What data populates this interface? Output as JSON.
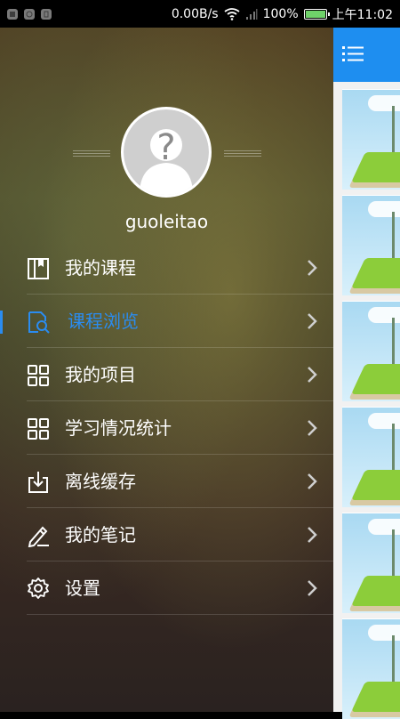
{
  "status_bar": {
    "net_speed": "0.00B/s",
    "battery_percent": "100%",
    "time": "上午11:02"
  },
  "drawer": {
    "username": "guoleitao",
    "items": [
      {
        "label": "我的课程",
        "icon": "book-icon",
        "active": false
      },
      {
        "label": "课程浏览",
        "icon": "course-browse-icon",
        "active": true
      },
      {
        "label": "我的项目",
        "icon": "grid-icon",
        "active": false
      },
      {
        "label": "学习情况统计",
        "icon": "grid-icon",
        "active": false
      },
      {
        "label": "离线缓存",
        "icon": "download-icon",
        "active": false
      },
      {
        "label": "我的笔记",
        "icon": "pencil-icon",
        "active": false
      },
      {
        "label": "设置",
        "icon": "gear-icon",
        "active": false
      }
    ]
  },
  "colors": {
    "accent": "#2a8cf0",
    "topbar": "#1e8ef0",
    "battery": "#6fd16a"
  }
}
